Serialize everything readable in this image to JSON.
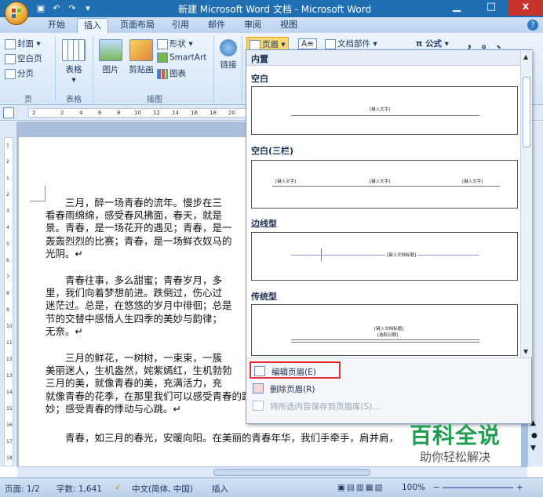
{
  "window": {
    "title": "新建 Microsoft Word 文档 - Microsoft Word",
    "minimize": "▁",
    "maximize": "□",
    "close": "x"
  },
  "quick_access": [
    "save-icon",
    "undo-icon",
    "redo-icon",
    "customize-icon"
  ],
  "tabs": [
    {
      "label": "开始"
    },
    {
      "label": "插入",
      "active": true
    },
    {
      "label": "页面布局"
    },
    {
      "label": "引用"
    },
    {
      "label": "邮件"
    },
    {
      "label": "审阅"
    },
    {
      "label": "视图"
    }
  ],
  "ribbon": {
    "pages": {
      "cover": "封面 ▾",
      "blank": "空白页",
      "break": "分页",
      "label": "页"
    },
    "table": {
      "button": "表格",
      "arrow": "▾",
      "label": "表格"
    },
    "illustrations": {
      "picture": "图片",
      "clipart": "剪贴画",
      "shapes": "形状 ▾",
      "smartart": "SmartArt",
      "chart": "图表",
      "label": "插图"
    },
    "links": {
      "button": "链接"
    },
    "header": {
      "button": "页眉 ▾"
    },
    "textbox": {
      "icon": "A≡"
    },
    "parts": {
      "button": "文档部件 ▾"
    },
    "equation": {
      "button": "π 公式 ▾"
    },
    "symbols": {
      "button": "，  。  、"
    }
  },
  "ruler": {
    "marks": [
      "2",
      "2",
      "4",
      "6",
      "8",
      "10",
      "12",
      "14",
      "16",
      "18",
      "20"
    ]
  },
  "vruler": {
    "marks": [
      "1",
      "2",
      "1",
      "2",
      "3",
      "4",
      "5",
      "6",
      "7",
      "8",
      "9",
      "10",
      "11",
      "12",
      "13",
      "14",
      "15",
      "16",
      "17",
      "18"
    ]
  },
  "document": {
    "paragraphs": [
      [
        "　　三月，醉一场青春的流年。慢步在三",
        "看春雨绵绵，感受春风拂面，春天，就是",
        "景。青春，是一场花开的遇见；青春，是一",
        "轰轰烈烈的比赛；青春，是一场鲜衣奴马的",
        "光阴。↵"
      ],
      [
        "　　青春往事，多么甜蜜；青春岁月，多",
        "里，我们向着梦想前进。跌倒过，伤心过",
        "迷茫过。总是，在悠悠的岁月中徘徊；总是",
        "节的交替中感悟人生四季的美妙与韵律；",
        "无奈。↵"
      ],
      [
        "　　三月的鲜花，一树树，一束束，一簇",
        "美丽迷人，生机盎然，姹紫嫣红，生机勃勃",
        "三月的美，就像青春的美，充满活力，充",
        "就像青春的花季，在那里我们可以感受青春的跳动与感动，感受青春的美",
        "妙；感受青春的悸动与心跳。↵"
      ],
      [
        "　　青春，如三月的春光，安暖向阳。在美丽的青春年华，我们手牵手，肩并肩，"
      ]
    ]
  },
  "header_gallery": {
    "header": "内置",
    "sections": [
      {
        "title": "空白",
        "texts": [
          "[键入文字]"
        ]
      },
      {
        "title": "空白(三栏)",
        "texts": [
          "[键入文字]",
          "[键入文字]",
          "[键入文字]"
        ]
      },
      {
        "title": "边线型",
        "texts": [
          "[键入文档标题]"
        ]
      },
      {
        "title": "传统型",
        "texts": [
          "[键入文档标题]",
          "[选取日期]"
        ]
      }
    ],
    "menu": {
      "edit": "编辑页眉(E)",
      "remove": "删除页眉(R)",
      "save": "将所选内容保存到页眉库(S)..."
    }
  },
  "status": {
    "page": "页面: 1/2",
    "words": "字数: 1,641",
    "lang": "中文(简体, 中国)",
    "mode": "插入",
    "zoom": "100%",
    "zoom_out": "−",
    "zoom_in": "+"
  },
  "watermark": {
    "big": "百科全说",
    "small": "助你轻松解决"
  },
  "colors": {
    "accent": "#1f6fb2",
    "highlight": "#e33030",
    "watermark": "#1f9e51"
  }
}
